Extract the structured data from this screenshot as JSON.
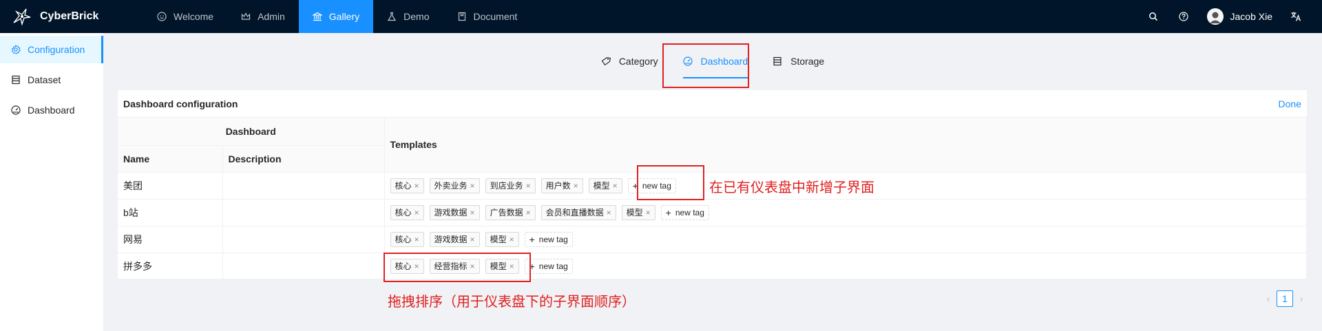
{
  "app": {
    "title": "CyberBrick"
  },
  "topnav": [
    {
      "label": "Welcome",
      "icon": "smile-icon"
    },
    {
      "label": "Admin",
      "icon": "crown-icon"
    },
    {
      "label": "Gallery",
      "icon": "bank-icon",
      "active": true
    },
    {
      "label": "Demo",
      "icon": "experiment-icon"
    },
    {
      "label": "Document",
      "icon": "book-icon"
    }
  ],
  "user": {
    "name": "Jacob Xie"
  },
  "sidebar": {
    "items": [
      {
        "label": "Configuration",
        "active": true
      },
      {
        "label": "Dataset"
      },
      {
        "label": "Dashboard"
      }
    ]
  },
  "tabs": [
    {
      "label": "Category"
    },
    {
      "label": "Dashboard",
      "active": true
    },
    {
      "label": "Storage"
    }
  ],
  "card": {
    "title": "Dashboard configuration",
    "done_label": "Done"
  },
  "table": {
    "group_header": "Dashboard",
    "col_name": "Name",
    "col_description": "Description",
    "col_templates": "Templates",
    "new_tag_label": "new tag",
    "rows": [
      {
        "name": "美团",
        "description": "",
        "tags": [
          "核心",
          "外卖业务",
          "到店业务",
          "用户数",
          "模型"
        ]
      },
      {
        "name": "b站",
        "description": "",
        "tags": [
          "核心",
          "游戏数据",
          "广告数据",
          "会员和直播数据",
          "模型"
        ]
      },
      {
        "name": "网易",
        "description": "",
        "tags": [
          "核心",
          "游戏数据",
          "模型"
        ]
      },
      {
        "name": "拼多多",
        "description": "",
        "tags": [
          "核心",
          "经营指标",
          "模型"
        ]
      }
    ]
  },
  "annotations": {
    "new_tag_note": "在已有仪表盘中新增子界面",
    "drag_note": "拖拽排序（用于仪表盘下的子界面顺序）",
    "color": "#e02020"
  },
  "pagination": {
    "current": "1"
  },
  "colors": {
    "accent": "#1890ff",
    "header_bg": "#001529"
  }
}
